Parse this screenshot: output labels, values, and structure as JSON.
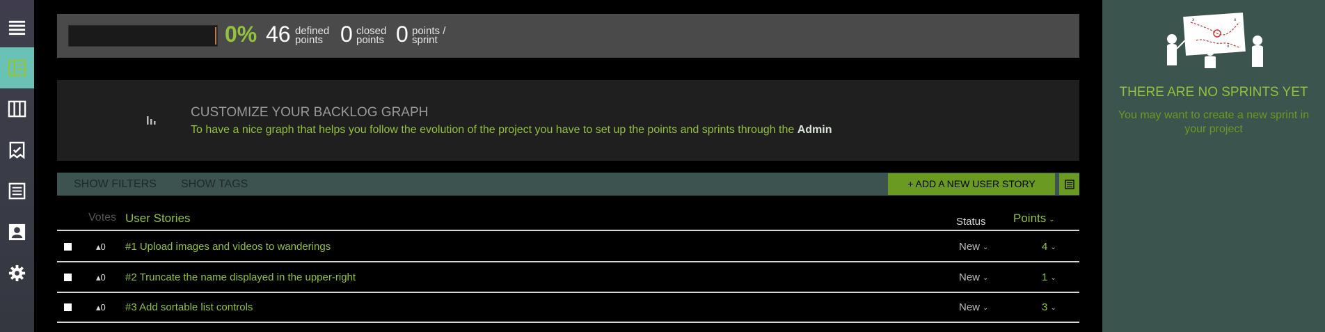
{
  "sidebar": {
    "items": [
      {
        "name": "menu",
        "icon": "hamburger-menu-icon"
      },
      {
        "name": "backlog",
        "icon": "backlog-icon",
        "active": true
      },
      {
        "name": "kanban",
        "icon": "kanban-icon"
      },
      {
        "name": "wiki",
        "icon": "wiki-icon"
      },
      {
        "name": "issues",
        "icon": "issues-icon"
      },
      {
        "name": "team",
        "icon": "team-icon"
      },
      {
        "name": "admin",
        "icon": "gear-icon"
      }
    ],
    "active_color": "#6ac2b7"
  },
  "stats": {
    "progress_fraction": 0.0,
    "percent": "0%",
    "defined_num": "46",
    "defined_label_1": "defined",
    "defined_label_2": "points",
    "closed_num": "0",
    "closed_label_1": "closed",
    "closed_label_2": "points",
    "sprint_num": "0",
    "sprint_label_1": "points /",
    "sprint_label_2": "sprint"
  },
  "graph_empty": {
    "title": "CUSTOMIZE YOUR BACKLOG GRAPH",
    "text": "To have a nice graph that helps you follow the evolution of the project you have to set up the points and sprints through the",
    "link": "Admin",
    "icon": "bar-chart-icon"
  },
  "filters": {
    "show_filters": "SHOW FILTERS",
    "show_tags": "SHOW TAGS",
    "add_story": "+ ADD A NEW USER STORY",
    "view_icon": "table-view-icon"
  },
  "table": {
    "col_votes": "Votes",
    "col_stories": "User Stories",
    "col_status": "Status",
    "col_points": "Points",
    "rows": [
      {
        "votes": "0",
        "subject": "#1 Upload images and videos to wanderings",
        "status": "New",
        "points": "4"
      },
      {
        "votes": "0",
        "subject": "#2 Truncate the name displayed in the upper-right",
        "status": "New",
        "points": "1"
      },
      {
        "votes": "0",
        "subject": "#3 Add sortable list controls",
        "status": "New",
        "points": "3"
      }
    ]
  },
  "sprints_panel": {
    "title": "THERE ARE NO SPRINTS YET",
    "subtitle": "You may want to create a new sprint in your project",
    "illustration_icon": "team-whiteboard-icon"
  },
  "colors": {
    "accent_green": "#93c23c",
    "button_green": "#6a9a22",
    "panel_teal": "#3b544e"
  }
}
